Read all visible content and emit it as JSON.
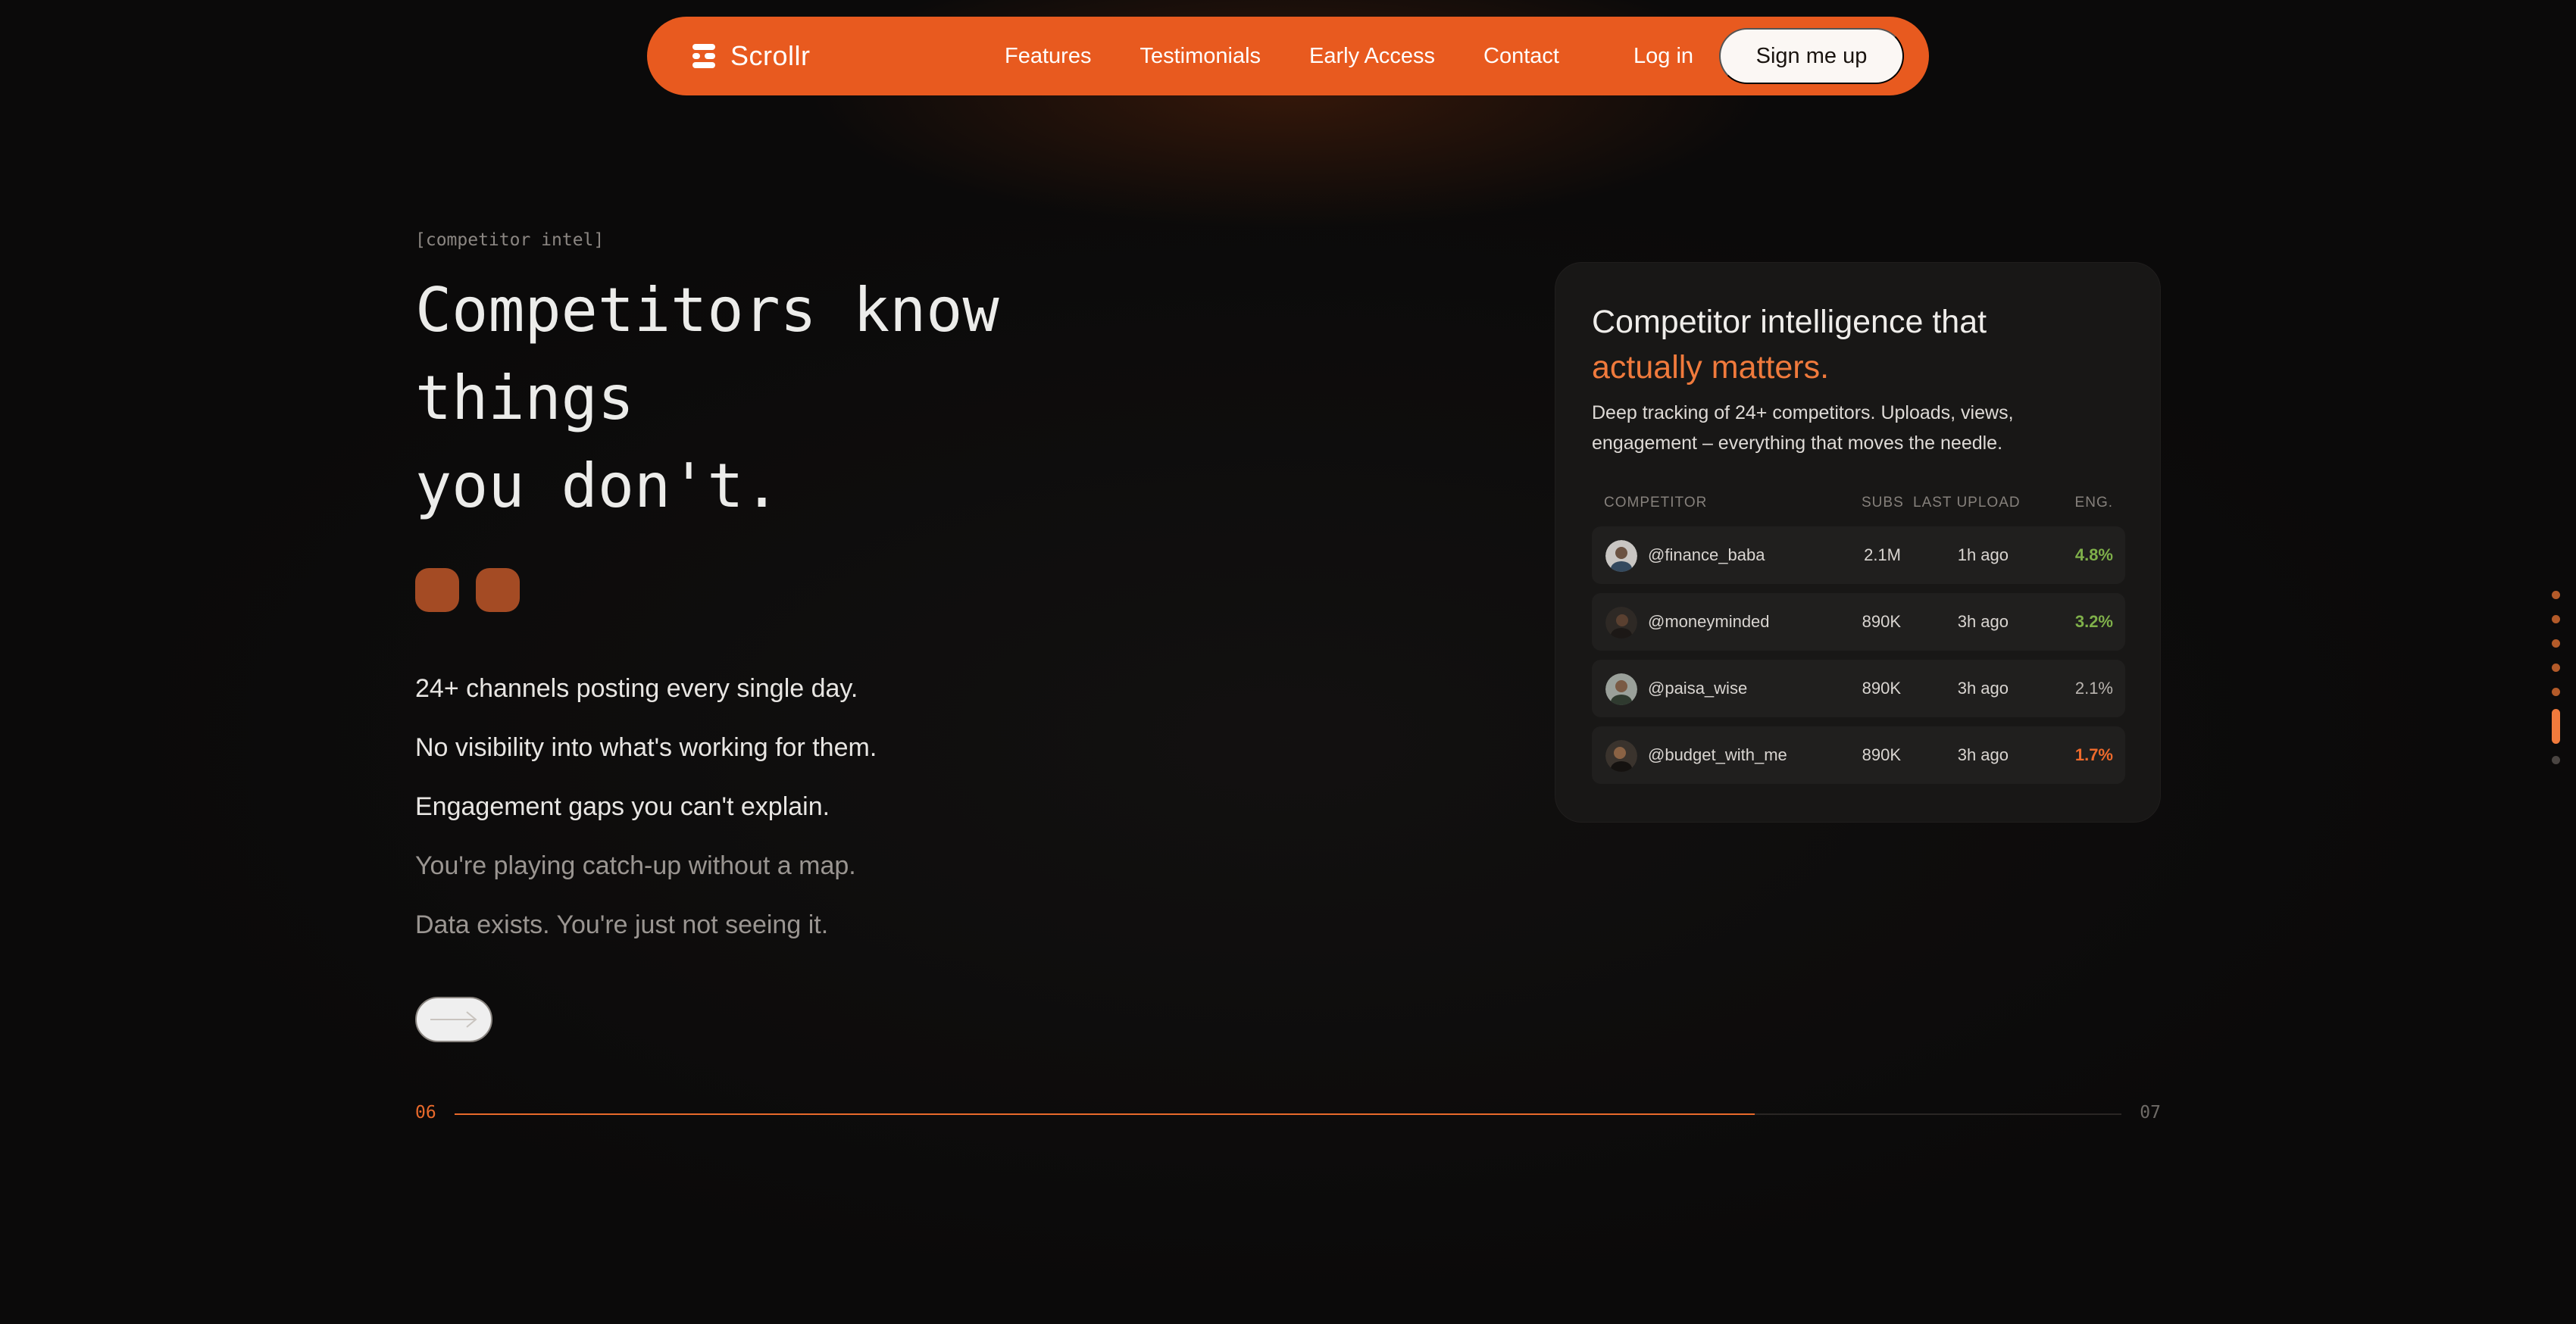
{
  "nav": {
    "brand": "Scrollr",
    "links": [
      "Features",
      "Testimonials",
      "Early Access",
      "Contact"
    ],
    "login": "Log in",
    "signup": "Sign me up",
    "accent_color": "#e85a1f"
  },
  "hero": {
    "eyebrow": "[competitor intel]",
    "headline": [
      "Competitors know",
      "things",
      "you don't."
    ],
    "lines": [
      "24+ channels posting every single day.",
      "No visibility into what's working for them.",
      "Engagement gaps you can't explain.",
      "You're playing catch-up without a map.",
      "Data exists. You're just not seeing it."
    ],
    "arrow_icon": "arrow-right-icon"
  },
  "progress": {
    "current": "06",
    "next": "07",
    "fraction": 0.78
  },
  "card": {
    "title": "Competitor intelligence that",
    "title_accent": "actually matters.",
    "description": "Deep tracking of 24+ competitors. Uploads, views, engagement – everything that moves the needle.",
    "columns": [
      "COMPETITOR",
      "SUBS",
      "LAST UPLOAD",
      "ENG."
    ],
    "rows": [
      {
        "handle": "@finance_baba",
        "subs": "2.1M",
        "upload": "1h ago",
        "eng": "4.8%",
        "eng_color": "#7fb04a"
      },
      {
        "handle": "@moneyminded",
        "subs": "890K",
        "upload": "3h ago",
        "eng": "3.2%",
        "eng_color": "#7fb04a"
      },
      {
        "handle": "@paisa_wise",
        "subs": "890K",
        "upload": "3h ago",
        "eng": "2.1%",
        "eng_color": "#bab5b0"
      },
      {
        "handle": "@budget_with_me",
        "subs": "890K",
        "upload": "3h ago",
        "eng": "1.7%",
        "eng_color": "#ee6a2c"
      }
    ]
  },
  "section_nav": {
    "count": 7,
    "active_index": 5
  }
}
